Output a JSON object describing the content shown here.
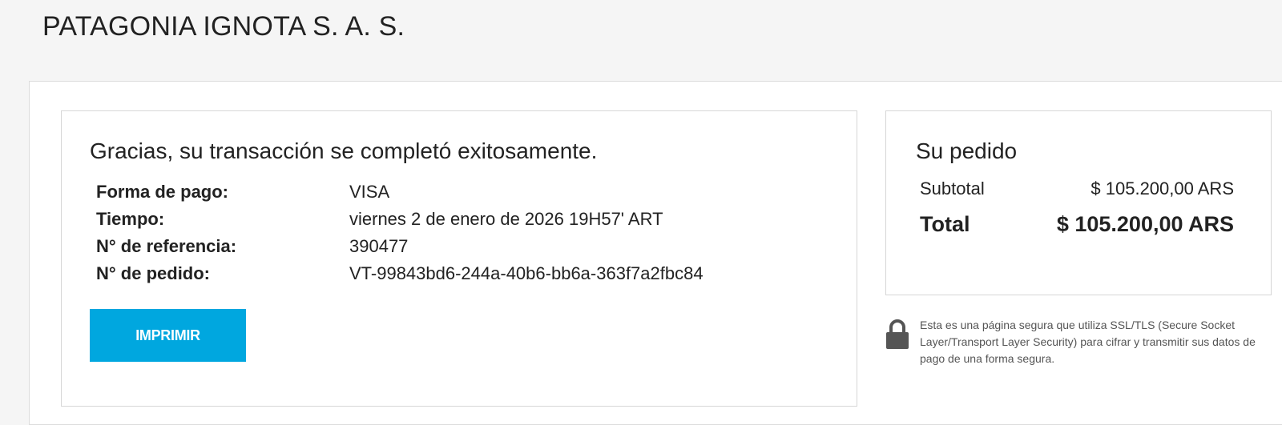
{
  "merchant": {
    "name": "PATAGONIA IGNOTA S. A. S."
  },
  "confirmation": {
    "message": "Gracias, su transacción se completó exitosamente.",
    "details": [
      {
        "label": "Forma de pago:",
        "value": "VISA"
      },
      {
        "label": "Tiempo:",
        "value": "viernes 2 de enero de 2026 19H57' ART"
      },
      {
        "label": "N° de referencia:",
        "value": "390477"
      },
      {
        "label": "N° de pedido:",
        "value": "VT-99843bd6-244a-40b6-bb6a-363f7a2fbc84"
      }
    ],
    "print_label": "IMPRIMIR"
  },
  "order": {
    "title": "Su pedido",
    "subtotal_label": "Subtotal",
    "subtotal_value": "$ 105.200,00 ARS",
    "total_label": "Total",
    "total_value": "$ 105.200,00 ARS"
  },
  "security": {
    "icon": "lock-icon",
    "text": "Esta es una página segura que utiliza SSL/TLS (Secure Socket Layer/Transport Layer Security) para cifrar y transmitir sus datos de pago de una forma segura."
  },
  "colors": {
    "accent": "#00a7df",
    "background": "#f5f5f5",
    "card": "#ffffff",
    "border": "#d6d6d6"
  }
}
